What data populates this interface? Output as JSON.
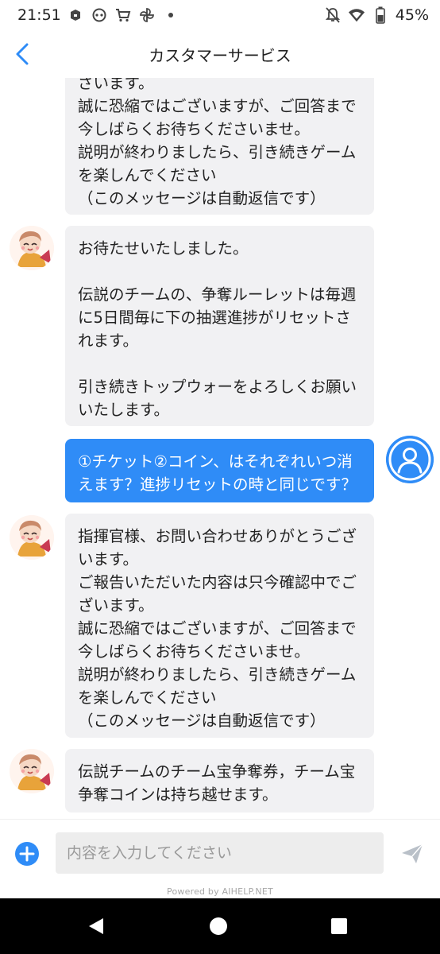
{
  "status_bar": {
    "time": "21:51",
    "battery_percent": "45%",
    "icons_left": [
      "app-notification-icon",
      "gamepad-icon",
      "shopping-cart-icon",
      "pinwheel-icon",
      "dot-icon"
    ],
    "icons_right": [
      "notifications-off-icon",
      "wifi-icon",
      "battery-icon"
    ]
  },
  "header": {
    "title": "カスタマーサービス",
    "back_icon": "chevron-left-icon"
  },
  "messages": [
    {
      "sender": "agent",
      "text": "ざいます。\n誠に恐縮ではございますが、ご回答まで\n今しばらくお待ちくださいませ。\n説明が終わりましたら、引き続きゲーム\nを楽しんでください\n（このメッセージは自動返信です）"
    },
    {
      "sender": "agent",
      "text": "お待たせいたしました。\n\n伝説のチームの、争奪ルーレットは毎週\nに5日間毎に下の抽選進捗がリセットさ\nれます。\n\n引き続きトップウォーをよろしくお願い\nいたします。"
    },
    {
      "sender": "user",
      "text": "①チケット②コイン、はそれぞれいつ消\nえます？進捗リセットの時と同じです？"
    },
    {
      "sender": "agent",
      "text": "指揮官様、お問い合わせありがとうござ\nいます。\nご報告いただいた内容は只今確認中でご\nざいます。\n誠に恐縮ではございますが、ご回答まで\n今しばらくお待ちくださいませ。\n説明が終わりましたら、引き続きゲーム\nを楽しんでください\n（このメッセージは自動返信です）"
    },
    {
      "sender": "agent",
      "text": "伝説チームのチーム宝争奪券，チーム宝\n争奪コインは持ち越せます。"
    }
  ],
  "input": {
    "placeholder": "内容を入力してください",
    "value": "",
    "add_icon": "plus-circle-icon",
    "send_icon": "send-icon"
  },
  "footer": {
    "powered_by": "Powered by AIHELP.NET"
  },
  "nav": {
    "buttons": [
      "back-triangle-icon",
      "home-circle-icon",
      "recents-square-icon"
    ]
  },
  "colors": {
    "accent": "#2f8cf7",
    "bubble_agent": "#f1f1f3",
    "bubble_user": "#2f8cf7",
    "nav_bar": "#000000"
  }
}
